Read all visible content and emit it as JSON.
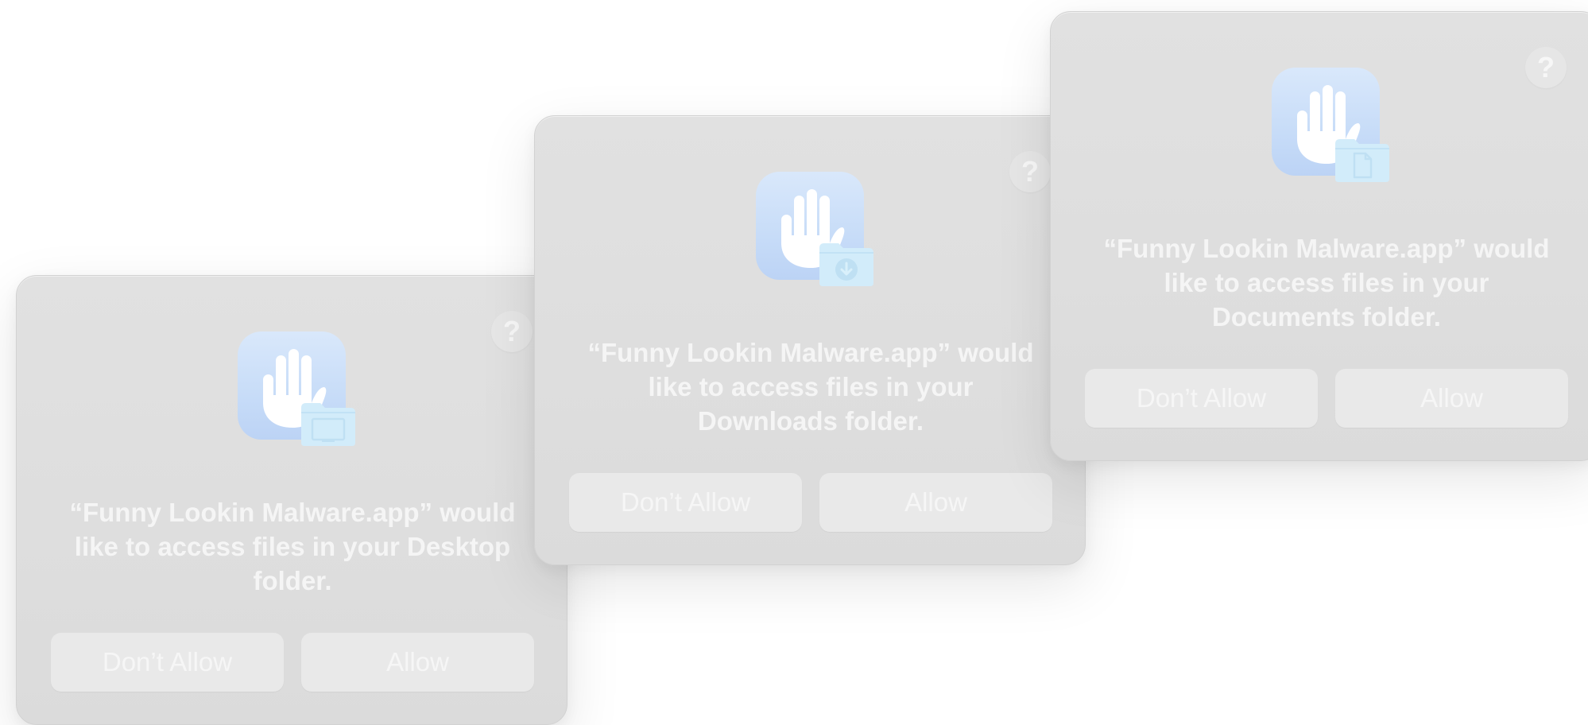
{
  "dialogs": [
    {
      "folder": "Desktop",
      "help_label": "?",
      "icon": "privacy-hand-icon",
      "folder_icon": "desktop-folder-icon",
      "message": "“Funny Lookin Malware.app” would like to access files in your Desktop folder.",
      "deny_label": "Don’t Allow",
      "allow_label": "Allow"
    },
    {
      "folder": "Downloads",
      "help_label": "?",
      "icon": "privacy-hand-icon",
      "folder_icon": "downloads-folder-icon",
      "message": "“Funny Lookin Malware.app” would like to access files in your Downloads folder.",
      "deny_label": "Don’t Allow",
      "allow_label": "Allow"
    },
    {
      "folder": "Documents",
      "help_label": "?",
      "icon": "privacy-hand-icon",
      "folder_icon": "documents-folder-icon",
      "message": "“Funny Lookin Malware.app” would like to access files in your Documents folder.",
      "deny_label": "Don’t Allow",
      "allow_label": "Allow"
    }
  ],
  "colors": {
    "dialog_background": "#dedede",
    "button_background": "#e9e9e9",
    "icon_tile": "#c7dcf8",
    "folder_fill": "#d2ecfa",
    "text": "#f5f5f5"
  }
}
